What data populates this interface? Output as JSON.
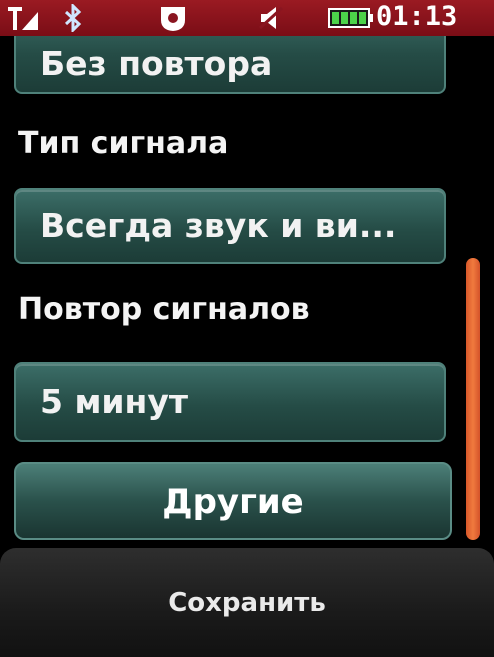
{
  "status_bar": {
    "time": "01:13",
    "icons": [
      "signal-icon",
      "bluetooth-icon",
      "profile-icon",
      "mute-icon",
      "battery-icon"
    ],
    "battery_level": 1.0,
    "accent_color": "#8a1520"
  },
  "settings": {
    "repeat_mode_value": "Без повтора",
    "signal_type_label": "Тип сигнала",
    "signal_type_value": "Всегда звук и ви...",
    "signal_repeat_label": "Повтор сигналов",
    "signal_repeat_value": "5 минут",
    "other_button_label": "Другие"
  },
  "softkeys": {
    "save_label": "Сохранить"
  },
  "scrollbar": {
    "color": "#e8693a"
  }
}
